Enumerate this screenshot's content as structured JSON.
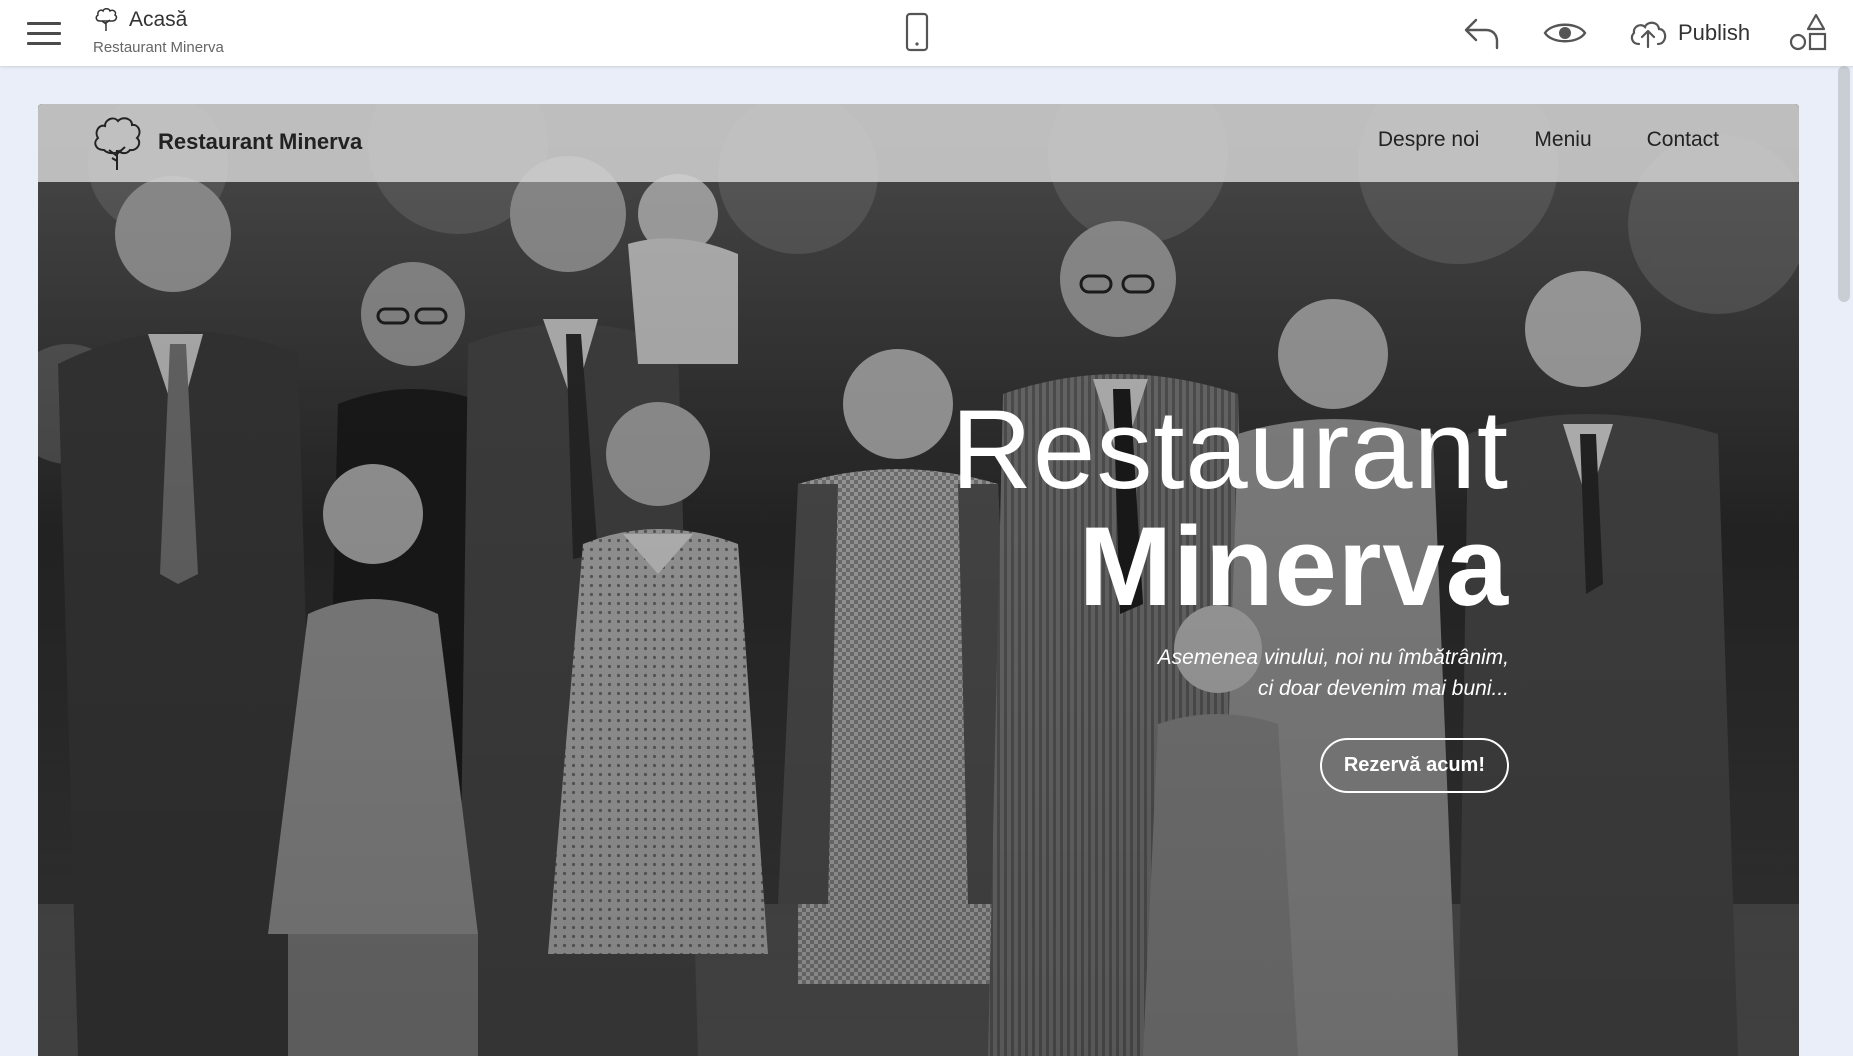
{
  "editor": {
    "page_title": "Acasă",
    "site_name": "Restaurant Minerva",
    "publish_label": "Publish"
  },
  "site": {
    "brand": "Restaurant Minerva",
    "nav": [
      {
        "label": "Despre noi"
      },
      {
        "label": "Meniu"
      },
      {
        "label": "Contact"
      }
    ],
    "hero": {
      "title_light": "Restaurant",
      "title_bold": "Minerva",
      "tagline_line1": "Asemenea vinului, noi nu îmbătrânim,",
      "tagline_line2": "ci doar devenim mai buni...",
      "cta_label": "Rezervă acum!"
    }
  },
  "icons": {
    "menu": "hamburger-icon",
    "page": "tree-icon",
    "device": "mobile-phone-icon",
    "undo": "undo-arrow-icon",
    "preview": "eye-icon",
    "publish": "cloud-upload-icon",
    "blocks": "blocks-shapes-icon",
    "site_logo": "tree-logo-icon"
  },
  "colors": {
    "editor_background": "#e9eef8",
    "topbar": "#ffffff",
    "site_nav": "#d2d2d2",
    "hero_text": "#ffffff"
  }
}
